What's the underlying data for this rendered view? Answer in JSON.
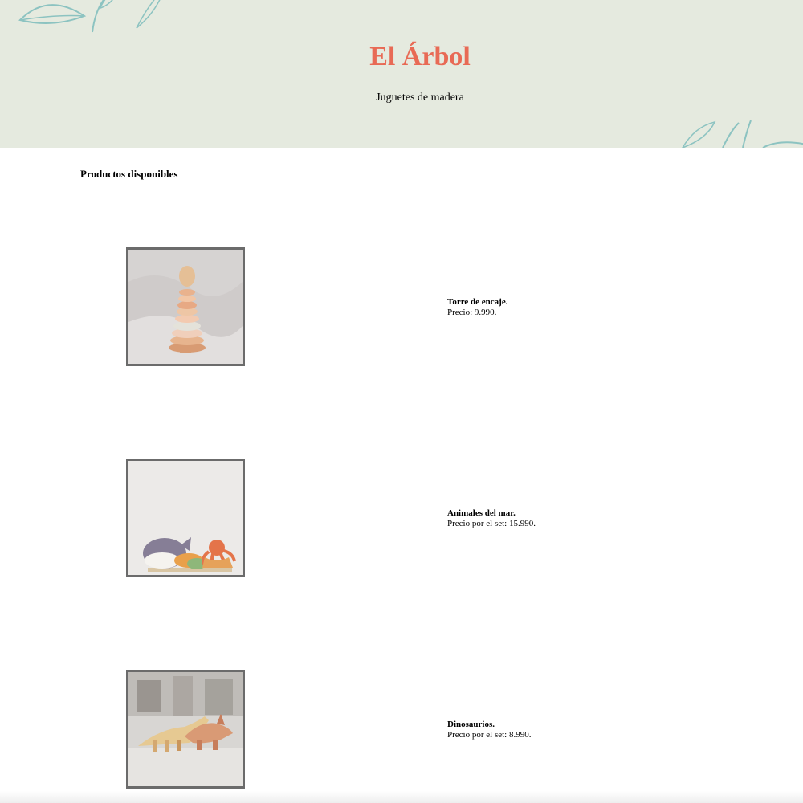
{
  "header": {
    "title": "El Árbol",
    "subtitle": "Juguetes de madera",
    "background_color": "#e5eadf",
    "title_color": "#e86a55"
  },
  "main": {
    "section_heading": "Productos disponibles",
    "products": [
      {
        "name": "Torre de encaje.",
        "price_text": "Precio: 9.990.",
        "image": "stacking-tower-photo"
      },
      {
        "name": "Animales del mar.",
        "price_text": "Precio por el set: 15.990.",
        "image": "sea-animals-photo"
      },
      {
        "name": "Dinosaurios.",
        "price_text": "Precio por el set: 8.990.",
        "image": "dinosaurs-photo"
      }
    ]
  }
}
